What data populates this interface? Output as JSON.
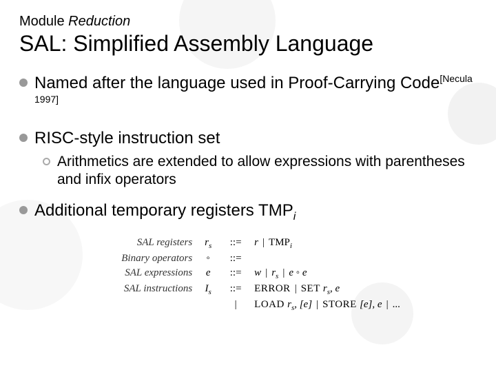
{
  "header": {
    "module_prefix": "Module ",
    "module_name": "Reduction",
    "title": "SAL: Simplified Assembly Language"
  },
  "bullets": {
    "b1_pre": "Named after the language used in Proof-Carrying Code",
    "b1_cite": "[Necula 1997]",
    "b2": "RISC-style instruction set",
    "b2_sub": "Arithmetics are extended to allow expressions with parentheses and infix operators",
    "b3_pre": "Additional temporary registers TMP",
    "b3_sub": "i"
  },
  "grammar": {
    "rows": [
      {
        "label": "SAL registers",
        "sym": "r",
        "sub": "s",
        "op": "::=",
        "rhs_html": "r | TMP_i"
      },
      {
        "label": "Binary operators",
        "sym": "◦",
        "sub": "",
        "op": "::=",
        "rhs_html": ""
      },
      {
        "label": "SAL expressions",
        "sym": "e",
        "sub": "",
        "op": "::=",
        "rhs_html": "w | r_s | e ◦ e"
      },
      {
        "label": "SAL instructions",
        "sym": "I",
        "sub": "s",
        "op": "::=",
        "rhs_html": "ERROR | SET r_s, e"
      },
      {
        "label": "",
        "sym": "",
        "sub": "",
        "op": "|",
        "rhs_html": "LOAD r_s, [e] | STORE [e], e | ..."
      }
    ],
    "r1_a": "r",
    "r1_b": "TMP",
    "r1_b_sub": "i",
    "r3_a": "w",
    "r3_b": "r",
    "r3_b_sub": "s",
    "r3_c": "e ◦ e",
    "r4_a": "ERROR",
    "r4_b": "SET ",
    "r4_c": "r",
    "r4_c_sub": "s",
    "r4_d": ", e",
    "r5_a": "LOAD ",
    "r5_b": "r",
    "r5_b_sub": "s",
    "r5_c": ", [e]",
    "r5_d": "STORE ",
    "r5_e": "[e], e",
    "r5_f": "..."
  }
}
